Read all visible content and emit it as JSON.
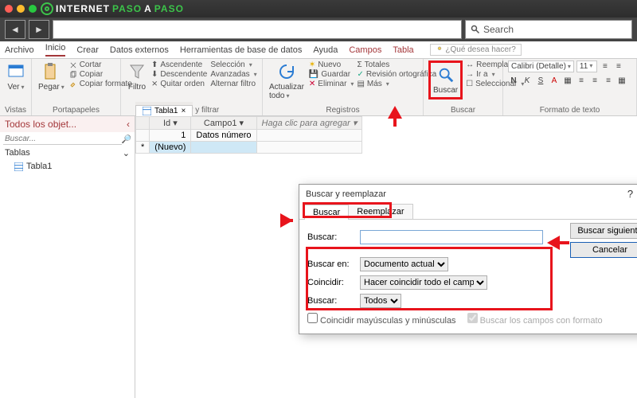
{
  "brand": {
    "pre": "INTERNET",
    "accent": "PASO",
    "mid": "A",
    "accent2": "PASO"
  },
  "browser": {
    "search_placeholder": "Search"
  },
  "menu": {
    "archivo": "Archivo",
    "inicio": "Inicio",
    "crear": "Crear",
    "externos": "Datos externos",
    "herr": "Herramientas de base de datos",
    "ayuda": "Ayuda",
    "campos": "Campos",
    "tabla": "Tabla",
    "tell": "¿Qué desea hacer?"
  },
  "ribbon": {
    "vistas": {
      "label": "Vistas",
      "ver": "Ver"
    },
    "clip": {
      "label": "Portapapeles",
      "pegar": "Pegar",
      "cortar": "Cortar",
      "copiar": "Copiar",
      "formato": "Copiar formato"
    },
    "sort": {
      "label": "Ordenar y filtrar",
      "filtro": "Filtro",
      "asc": "Ascendente",
      "desc": "Descendente",
      "quitar": "Quitar orden",
      "sel": "Selección",
      "avan": "Avanzadas",
      "alt": "Alternar filtro"
    },
    "rec": {
      "label": "Registros",
      "act": "Actualizar todo",
      "nuevo": "Nuevo",
      "guardar": "Guardar",
      "elim": "Eliminar",
      "tot": "Totales",
      "rev": "Revisión ortográfica",
      "mas": "Más"
    },
    "buscar": {
      "label": "Buscar",
      "btn": "Buscar",
      "reem": "Reemplazar",
      "ira": "Ir a",
      "sel": "Seleccionar"
    },
    "fmt": {
      "label": "Formato de texto",
      "font": "Calibri (Detalle)",
      "size": "11",
      "b": "N",
      "i": "K",
      "u": "S"
    }
  },
  "sidebar": {
    "title": "Todos los objet...",
    "search": "Buscar...",
    "section": "Tablas",
    "item": "Tabla1"
  },
  "tab": {
    "name": "Tabla1"
  },
  "grid": {
    "cols": {
      "id": "Id",
      "c1": "Campo1",
      "add": "Haga clic para agregar"
    },
    "row1": {
      "id": "1",
      "c1": "Datos número"
    },
    "newrow": "(Nuevo)"
  },
  "dlg": {
    "title": "Buscar y reemplazar",
    "tab1": "Buscar",
    "tab2": "Reemplazar",
    "f_buscar": "Buscar:",
    "f_en": "Buscar en:",
    "v_en": "Documento actual",
    "f_coin": "Coincidir:",
    "v_coin": "Hacer coincidir todo el campo",
    "f_dir": "Buscar:",
    "v_dir": "Todos",
    "chk1": "Coincidir mayúsculas y minúsculas",
    "chk2": "Buscar los campos con formato",
    "btn_next": "Buscar siguiente",
    "btn_cancel": "Cancelar"
  }
}
